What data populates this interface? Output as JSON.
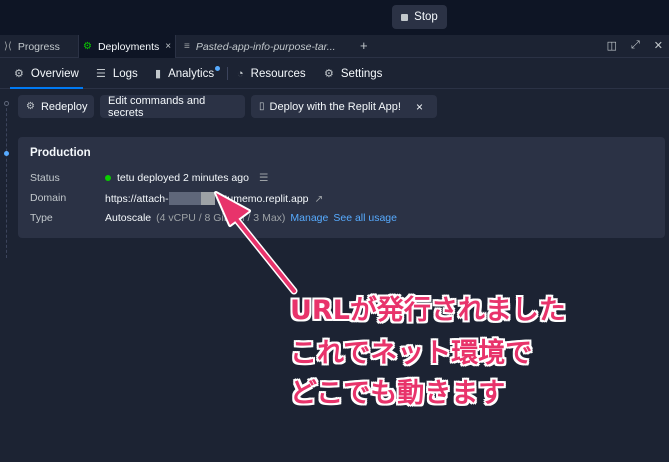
{
  "topbar": {
    "stop_label": "Stop"
  },
  "tabstrip": {
    "tabs": [
      {
        "label": "Progress"
      },
      {
        "label": "Deployments"
      },
      {
        "label": "Pasted-app-info-purpose-tar..."
      }
    ],
    "close_glyph": "×",
    "plus_glyph": "+"
  },
  "nav": {
    "tabs": [
      {
        "label": "Overview",
        "icon": "sparkle-icon"
      },
      {
        "label": "Logs",
        "icon": "list-icon"
      },
      {
        "label": "Analytics",
        "icon": "bar-chart-icon"
      },
      {
        "label": "Resources",
        "icon": "gauge-icon"
      },
      {
        "label": "Settings",
        "icon": "gear-icon"
      }
    ],
    "active_color": "#0079f2"
  },
  "actions": {
    "redeploy": "Redeploy",
    "edit_commands": "Edit commands and secrets",
    "deploy_app": "Deploy with the Replit App!",
    "dismiss": "×"
  },
  "production": {
    "title": "Production",
    "status_label": "Status",
    "status_value": "tetu deployed 2 minutes ago",
    "domain_label": "Domain",
    "domain_prefix": "https://attach-",
    "domain_suffix": "etumemo.replit.app",
    "type_label": "Type",
    "type_value": "Autoscale",
    "type_spec": "(4 vCPU / 8 GiB",
    "type_spec_tail": "M / 3 Max)",
    "manage_link": "Manage",
    "usage_link": "See all usage",
    "status_color": "#0ace00"
  },
  "annotation": {
    "lines": [
      "URLが発行されました",
      "これでネット環境で",
      "どこでも動きます"
    ],
    "color": "#e8336b"
  }
}
